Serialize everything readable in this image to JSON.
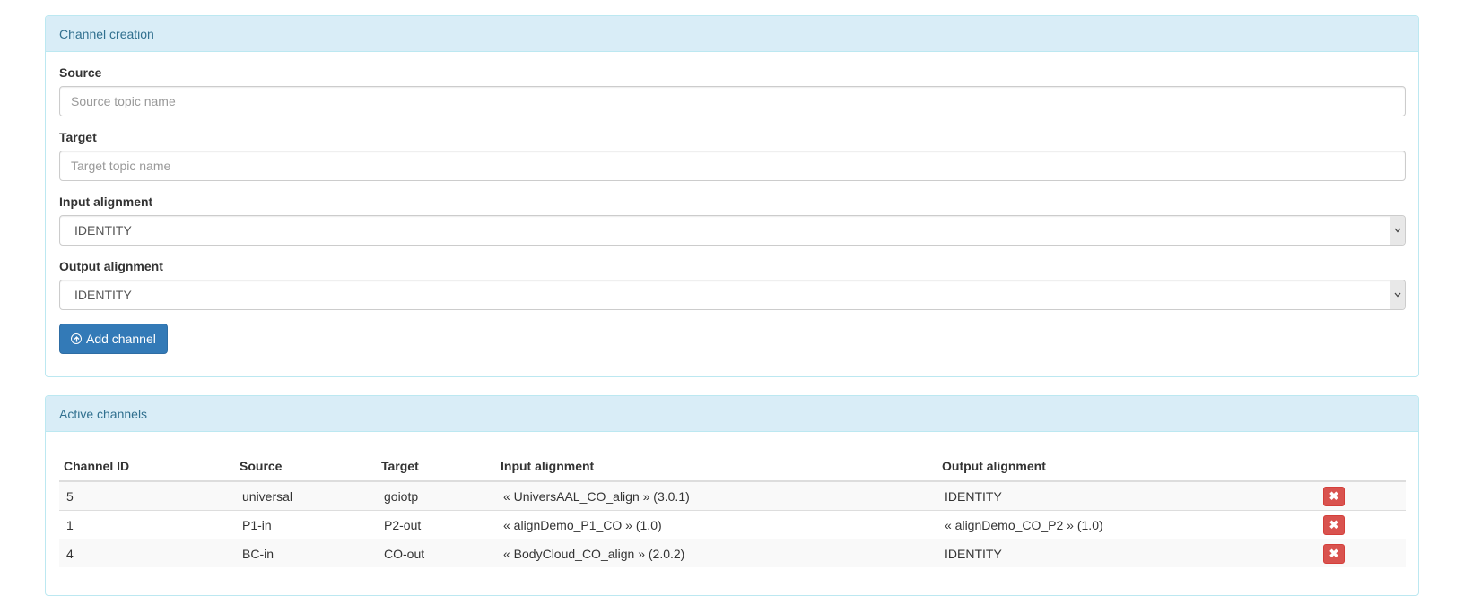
{
  "create_panel": {
    "title": "Channel creation",
    "source": {
      "label": "Source",
      "placeholder": "Source topic name",
      "value": ""
    },
    "target": {
      "label": "Target",
      "placeholder": "Target topic name",
      "value": ""
    },
    "input_alignment": {
      "label": "Input alignment",
      "selected": "IDENTITY"
    },
    "output_alignment": {
      "label": "Output alignment",
      "selected": "IDENTITY"
    },
    "add_button": {
      "label": "Add channel",
      "icon": "circle-arrow-up-icon"
    }
  },
  "active_panel": {
    "title": "Active channels",
    "columns": [
      "Channel ID",
      "Source",
      "Target",
      "Input alignment",
      "Output alignment"
    ],
    "rows": [
      {
        "id": "5",
        "source": "universal",
        "target": "goiotp",
        "input": "« UniversAAL_CO_align » (3.0.1)",
        "output": "IDENTITY"
      },
      {
        "id": "1",
        "source": "P1-in",
        "target": "P2-out",
        "input": "« alignDemo_P1_CO » (1.0)",
        "output": "« alignDemo_CO_P2 » (1.0)"
      },
      {
        "id": "4",
        "source": "BC-in",
        "target": "CO-out",
        "input": "« BodyCloud_CO_align » (2.0.2)",
        "output": "IDENTITY"
      }
    ],
    "delete_icon": "remove-icon"
  },
  "colors": {
    "panel_heading_bg": "#d9edf7",
    "panel_heading_text": "#31708f",
    "primary": "#337ab7",
    "danger": "#d9534f"
  }
}
